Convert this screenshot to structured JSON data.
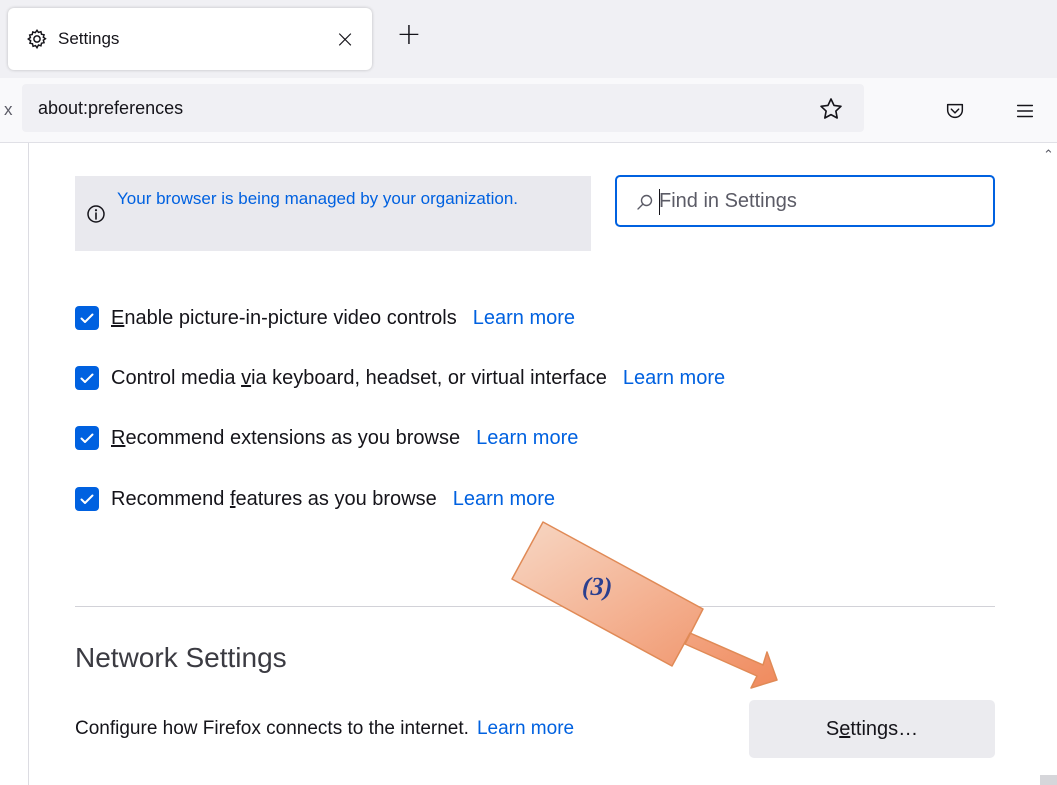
{
  "tab": {
    "title": "Settings",
    "close": "×"
  },
  "new_tab": "+",
  "navbar": {
    "url_fragment": "x",
    "url": "about:preferences"
  },
  "icons": {
    "tab": "gear-icon",
    "star": "star-icon",
    "pocket": "pocket-icon",
    "menu": "hamburger-menu-icon",
    "info": "info-icon",
    "search": "search-icon"
  },
  "managed_notice": "Your browser is being managed by your organization.",
  "search": {
    "placeholder": "Find in Settings",
    "value": ""
  },
  "checkboxes": [
    {
      "before": "",
      "mnemonic": "E",
      "after": "nable picture-in-picture video controls",
      "checked": true,
      "link": "Learn more"
    },
    {
      "before": "Control media ",
      "mnemonic": "v",
      "after": "ia keyboard, headset, or virtual interface",
      "checked": true,
      "link": "Learn more"
    },
    {
      "before": "",
      "mnemonic": "R",
      "after": "ecommend extensions as you browse",
      "checked": true,
      "link": "Learn more"
    },
    {
      "before": "Recommend ",
      "mnemonic": "f",
      "after": "eatures as you browse",
      "checked": true,
      "link": "Learn more"
    }
  ],
  "network": {
    "title": "Network Settings",
    "description": "Configure how Firefox connects to the internet.",
    "link": "Learn more",
    "button": {
      "before": "S",
      "mnemonic": "e",
      "after": "ttings…"
    }
  },
  "annotation": {
    "label": "(3)"
  },
  "colors": {
    "accent": "#0061e0",
    "tabstrip": "#f0f0f4",
    "arrow_fill_start": "#f7d7c4",
    "arrow_fill_end": "#f08a5d",
    "arrow_stroke": "#e08a56",
    "annotation_text": "#2a3f8f"
  }
}
